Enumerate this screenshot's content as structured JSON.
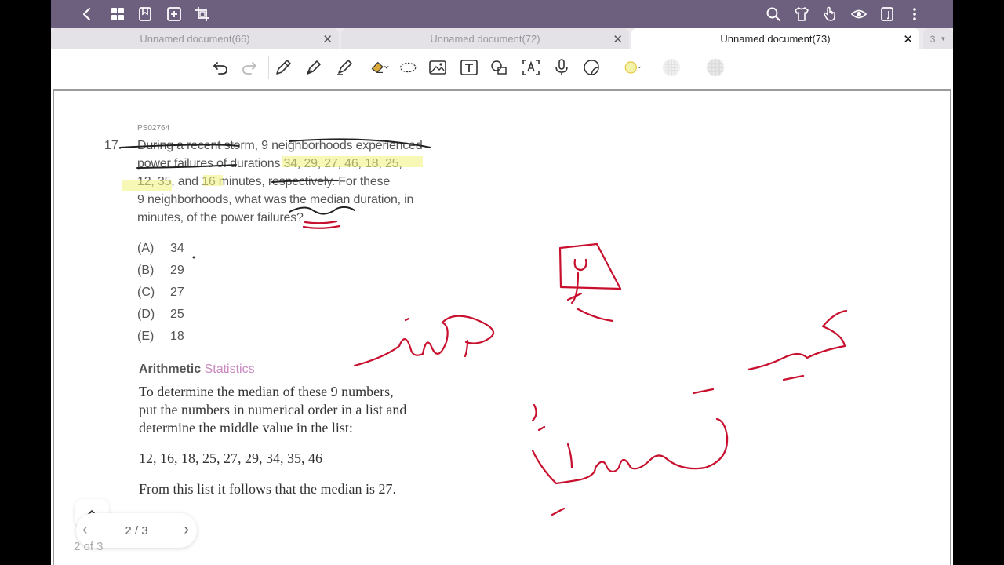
{
  "tabs": [
    {
      "label": "Unnamed document(66)",
      "active": false
    },
    {
      "label": "Unnamed document(72)",
      "active": false
    },
    {
      "label": "Unnamed document(73)",
      "active": true
    }
  ],
  "tab_overflow": {
    "count": "3"
  },
  "tab_close_glyph": "✕",
  "topbar": {
    "left_icons": [
      "back-icon",
      "grid-icon",
      "bookmark-icon",
      "add-page-icon",
      "crop-icon"
    ],
    "right_icons": [
      "search-icon",
      "shirt-icon",
      "hand-icon",
      "eye-icon",
      "document-icon",
      "more-icon"
    ],
    "color": "#6d5f7e"
  },
  "toolbar": {
    "tools": [
      "undo-icon",
      "redo-icon",
      "pen-icon",
      "fountain-pen-icon",
      "highlighter-icon",
      "eraser-icon",
      "lasso-icon",
      "image-icon",
      "text-box-icon",
      "shapes-icon",
      "text-recognition-icon",
      "microphone-icon",
      "sticker-icon",
      "color-swatch-icon",
      "color-swatch-2-icon",
      "color-swatch-3-icon"
    ]
  },
  "document": {
    "question_id": "PS02764",
    "question_number": "17.",
    "question_lines": [
      "During a recent storm, 9 neighborhoods experienced",
      "power failures of durations 34, 29, 27, 46, 18, 25,",
      "12, 35, and 16 minutes, respectively. For these",
      "9 neighborhoods, what was the median duration, in",
      "minutes, of the power failures?"
    ],
    "options": [
      {
        "letter": "(A)",
        "value": "34"
      },
      {
        "letter": "(B)",
        "value": "29"
      },
      {
        "letter": "(C)",
        "value": "27"
      },
      {
        "letter": "(D)",
        "value": "25"
      },
      {
        "letter": "(E)",
        "value": "18"
      }
    ],
    "category": "Arithmetic",
    "subcategory": "Statistics",
    "explanation_lines": [
      "To determine the median of these 9 numbers,",
      "put the numbers in numerical order in a list and",
      "determine the middle value in the list:"
    ],
    "ordered_list": "12, 16, 18, 25, 27, 29, 34, 35, 46",
    "conclusion": "From this list it follows that the median is 27."
  },
  "pager": {
    "label": "2 / 3",
    "prev": "‹",
    "next": "›"
  },
  "page_counter": "2 of 3",
  "ink_color": "#c8102e"
}
